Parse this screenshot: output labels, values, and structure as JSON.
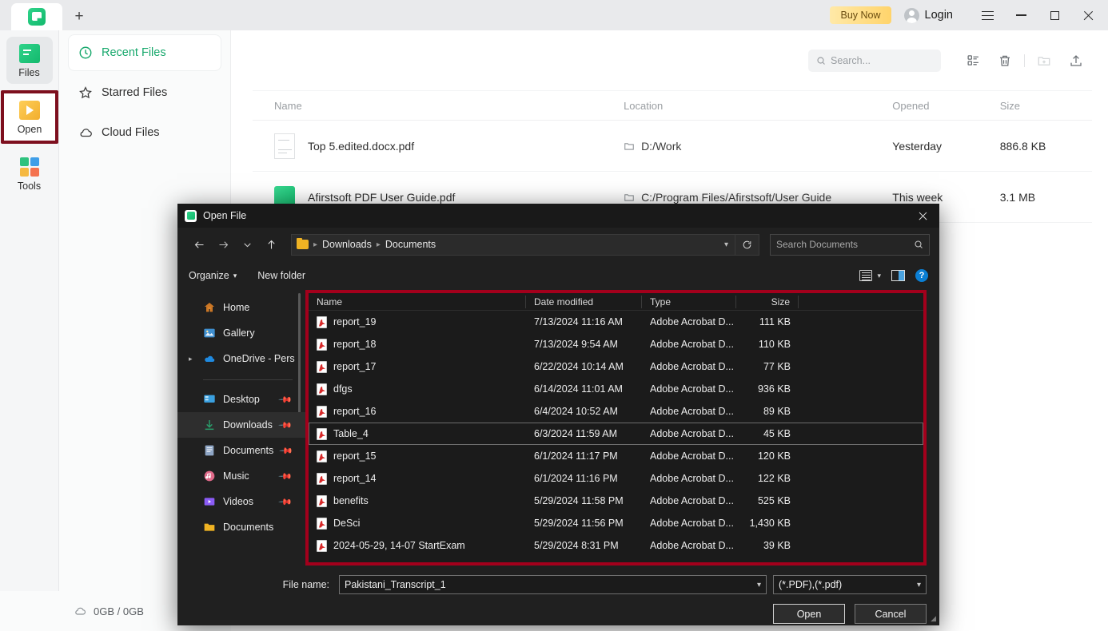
{
  "app": {
    "titlebar": {
      "tab_label": "",
      "new_tab_label": "+",
      "buy_now": "Buy Now",
      "login": "Login",
      "menu_icon": "hamburger-icon",
      "minimize_icon": "minimize-icon",
      "maximize_icon": "maximize-icon",
      "close_icon": "close-icon"
    },
    "rail": [
      {
        "label": "Files",
        "icon": "files-icon"
      },
      {
        "label": "Open",
        "icon": "open-folder-icon"
      },
      {
        "label": "Tools",
        "icon": "tools-grid-icon"
      }
    ],
    "nav": [
      {
        "label": "Recent Files",
        "icon": "clock-icon"
      },
      {
        "label": "Starred Files",
        "icon": "star-icon"
      },
      {
        "label": "Cloud Files",
        "icon": "cloud-icon"
      }
    ],
    "toolbar": {
      "search_placeholder": "Search...",
      "search_icon": "search-icon",
      "list_view_icon": "list-view-icon",
      "trash_icon": "trash-icon",
      "new_folder_icon": "new-folder-icon",
      "upload_icon": "upload-icon"
    },
    "table": {
      "columns": [
        "Name",
        "Location",
        "Opened",
        "Size"
      ],
      "rows": [
        {
          "name": "Top 5.edited.docx.pdf",
          "location": "D:/Work",
          "opened": "Yesterday",
          "size": "886.8 KB",
          "icon": "document-thumb-icon"
        },
        {
          "name": "Afirstsoft PDF User Guide.pdf",
          "location": "C:/Program Files/Afirstsoft/User Guide",
          "opened": "This week",
          "size": "3.1 MB",
          "icon": "pdf-green-icon"
        }
      ]
    },
    "statusbar": {
      "cloud_icon": "cloud-icon",
      "storage": "0GB / 0GB"
    }
  },
  "dialog": {
    "title": "Open File",
    "close_icon": "close-icon",
    "nav": {
      "back_icon": "arrow-left-icon",
      "forward_icon": "arrow-right-icon",
      "recent_icon": "chevron-down-icon",
      "up_icon": "arrow-up-icon",
      "breadcrumb": [
        "Downloads",
        "Documents"
      ],
      "breadcrumb_caret": "chevron-down-icon",
      "refresh_icon": "refresh-icon",
      "search_placeholder": "Search Documents",
      "search_icon": "search-icon"
    },
    "commandbar": {
      "organize": "Organize",
      "organize_caret": "chevron-down-icon",
      "new_folder": "New folder",
      "view_icon": "view-list-icon",
      "view_caret": "chevron-down-icon",
      "preview_pane_icon": "preview-pane-icon",
      "help_icon": "help-icon",
      "help_glyph": "?"
    },
    "sidebar": [
      {
        "label": "Home",
        "icon": "home-icon",
        "color": "#d9822b",
        "pin": false,
        "expander": false
      },
      {
        "label": "Gallery",
        "icon": "gallery-icon",
        "color": "#3f8fd0",
        "pin": false,
        "expander": false
      },
      {
        "label": "OneDrive - Pers",
        "icon": "onedrive-icon",
        "color": "#1f8ae0",
        "pin": false,
        "expander": true
      },
      {
        "label": "Desktop",
        "icon": "desktop-icon",
        "color": "#3aa0e0",
        "pin": true,
        "expander": false
      },
      {
        "label": "Downloads",
        "icon": "downloads-icon",
        "color": "#2a9d6b",
        "pin": true,
        "expander": false,
        "selected": true
      },
      {
        "label": "Documents",
        "icon": "documents-icon",
        "color": "#8fa6c6",
        "pin": true,
        "expander": false
      },
      {
        "label": "Music",
        "icon": "music-icon",
        "color": "#e06a8a",
        "pin": true,
        "expander": false
      },
      {
        "label": "Videos",
        "icon": "videos-icon",
        "color": "#8b5cf6",
        "pin": true,
        "expander": false
      },
      {
        "label": "Documents",
        "icon": "folder-icon",
        "color": "#f0b323",
        "pin": false,
        "expander": false
      }
    ],
    "filelist": {
      "columns": [
        "Name",
        "Date modified",
        "Type",
        "Size"
      ],
      "rows": [
        {
          "name": "report_19",
          "date": "7/13/2024 11:16 AM",
          "type": "Adobe Acrobat D...",
          "size": "111 KB",
          "selected": false
        },
        {
          "name": "report_18",
          "date": "7/13/2024 9:54 AM",
          "type": "Adobe Acrobat D...",
          "size": "110 KB",
          "selected": false
        },
        {
          "name": "report_17",
          "date": "6/22/2024 10:14 AM",
          "type": "Adobe Acrobat D...",
          "size": "77 KB",
          "selected": false
        },
        {
          "name": "dfgs",
          "date": "6/14/2024 11:01 AM",
          "type": "Adobe Acrobat D...",
          "size": "936 KB",
          "selected": false
        },
        {
          "name": "report_16",
          "date": "6/4/2024 10:52 AM",
          "type": "Adobe Acrobat D...",
          "size": "89 KB",
          "selected": false
        },
        {
          "name": "Table_4",
          "date": "6/3/2024 11:59 AM",
          "type": "Adobe Acrobat D...",
          "size": "45 KB",
          "selected": true
        },
        {
          "name": "report_15",
          "date": "6/1/2024 11:17 PM",
          "type": "Adobe Acrobat D...",
          "size": "120 KB",
          "selected": false
        },
        {
          "name": "report_14",
          "date": "6/1/2024 11:16 PM",
          "type": "Adobe Acrobat D...",
          "size": "122 KB",
          "selected": false
        },
        {
          "name": "benefits",
          "date": "5/29/2024 11:58 PM",
          "type": "Adobe Acrobat D...",
          "size": "525 KB",
          "selected": false
        },
        {
          "name": "DeSci",
          "date": "5/29/2024 11:56 PM",
          "type": "Adobe Acrobat D...",
          "size": "1,430 KB",
          "selected": false
        },
        {
          "name": "2024-05-29, 14-07 StartExam",
          "date": "5/29/2024 8:31 PM",
          "type": "Adobe Acrobat D...",
          "size": "39 KB",
          "selected": false
        }
      ]
    },
    "footer": {
      "filename_label": "File name:",
      "filename_value": "Pakistani_Transcript_1",
      "filetype_value": "(*.PDF),(*.pdf)",
      "open_button": "Open",
      "cancel_button": "Cancel",
      "caret_icon": "chevron-down-icon"
    }
  },
  "highlights": {
    "rail_open_color": "#7d0f1e",
    "filelist_color": "#a3001c"
  }
}
